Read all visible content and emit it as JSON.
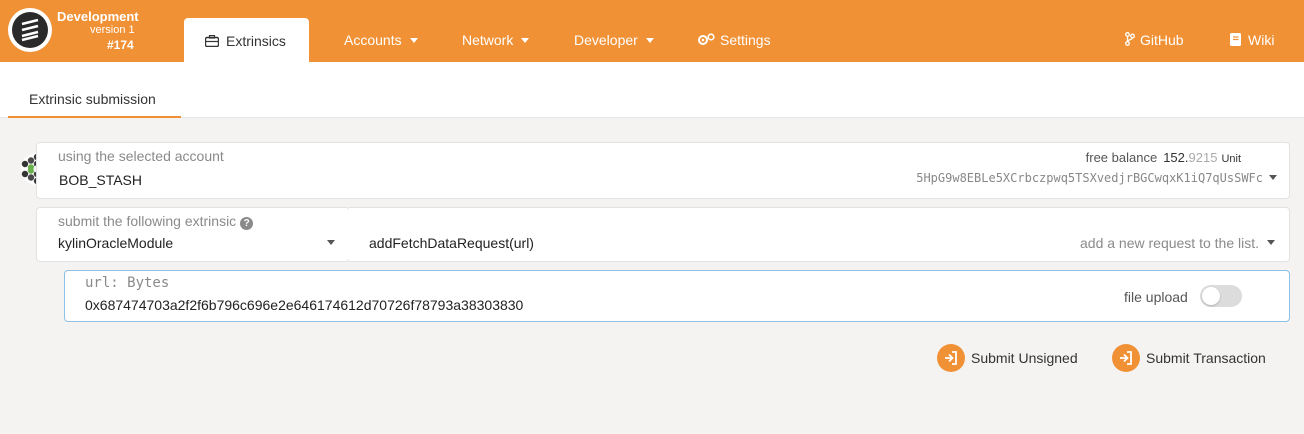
{
  "header": {
    "chain_name": "Development",
    "version": "version 1",
    "block": "#174",
    "active_tab": "Extrinsics",
    "menu": [
      {
        "label": "Accounts"
      },
      {
        "label": "Network"
      },
      {
        "label": "Developer"
      },
      {
        "label": "Settings"
      }
    ],
    "github": "GitHub",
    "wiki": "Wiki"
  },
  "subnav": {
    "tab": "Extrinsic submission"
  },
  "account": {
    "label": "using the selected account",
    "name": "BOB_STASH",
    "balance_label": "free balance",
    "balance_int": "152.",
    "balance_dec": "9215",
    "unit": "Unit",
    "address": "5HpG9w8EBLe5XCrbczpwq5TSXvedjrBGCwqxK1iQ7qUsSWFc"
  },
  "extrinsic": {
    "label": "submit the following extrinsic",
    "module": "kylinOracleModule",
    "method": "addFetchDataRequest(url)",
    "method_help": "add a new request to the list."
  },
  "param": {
    "label": "url: Bytes",
    "value": "0x687474703a2f2f6b796c696e2e646174612d70726f78793a38303830",
    "file_upload": "file upload",
    "file_upload_enabled": false
  },
  "actions": {
    "unsigned": "Submit Unsigned",
    "transaction": "Submit Transaction"
  },
  "colors": {
    "accent": "#f19135",
    "background": "#f4f3f2"
  }
}
